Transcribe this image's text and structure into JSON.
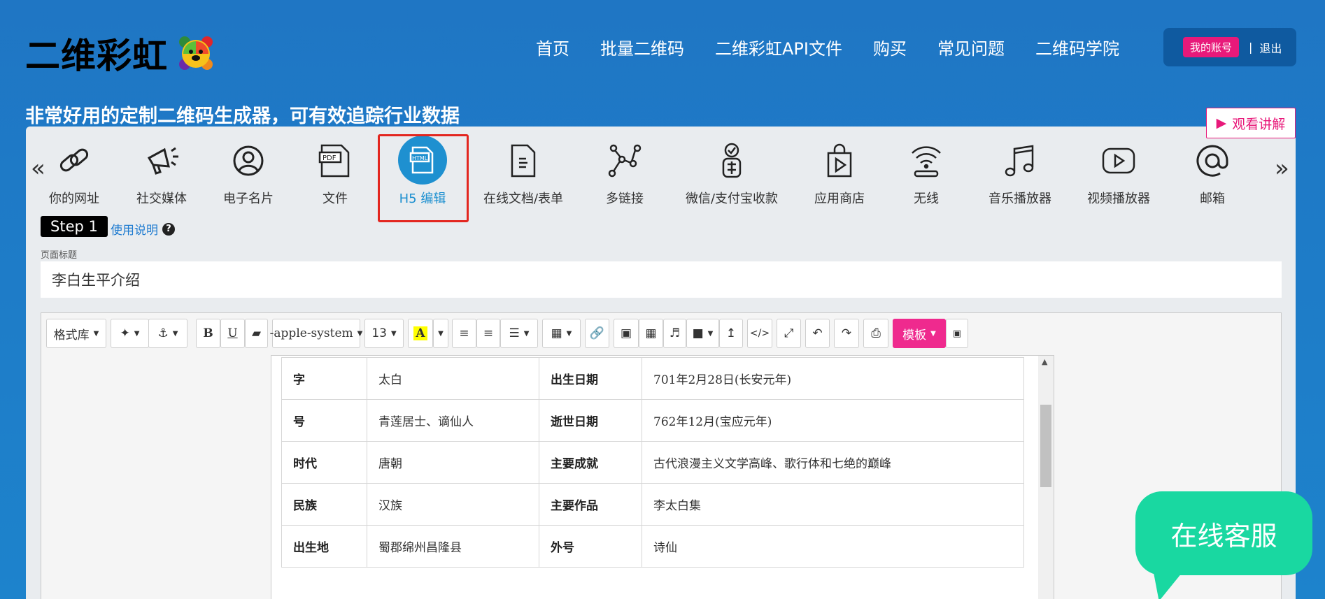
{
  "header": {
    "logo_text": "二维彩虹",
    "nav": [
      "首页",
      "批量二维码",
      "二维彩虹API文件",
      "购买",
      "常见问题",
      "二维码学院"
    ],
    "account_label": "我的账号",
    "separator": "|",
    "logout_label": "退出"
  },
  "slogan": "非常好用的定制二维码生成器，可有效追踪行业数据",
  "watch_button": {
    "icon": "play-icon",
    "label": "观看讲解"
  },
  "carousel": {
    "prev": "«",
    "next": "»",
    "types": [
      {
        "label": "你的网址",
        "icon": "link-icon"
      },
      {
        "label": "社交媒体",
        "icon": "megaphone-icon"
      },
      {
        "label": "电子名片",
        "icon": "user-circle-icon"
      },
      {
        "label": "文件",
        "icon": "pdf-file-icon"
      },
      {
        "label": "H5 编辑",
        "icon": "html-file-icon",
        "active": true
      },
      {
        "label": "在线文档/表单",
        "icon": "document-icon"
      },
      {
        "label": "多链接",
        "icon": "network-icon"
      },
      {
        "label": "微信/支付宝收款",
        "icon": "payment-icon"
      },
      {
        "label": "应用商店",
        "icon": "shopping-bag-icon"
      },
      {
        "label": "无线",
        "icon": "wifi-icon"
      },
      {
        "label": "音乐播放器",
        "icon": "music-icon"
      },
      {
        "label": "视频播放器",
        "icon": "video-play-icon"
      },
      {
        "label": "邮箱",
        "icon": "at-sign-icon"
      }
    ]
  },
  "step": {
    "label": "Step 1",
    "help_label": "使用说明",
    "help_icon": "?"
  },
  "page_title": {
    "label": "页面标题",
    "value": "李白生平介绍"
  },
  "toolbar": {
    "style": "格式库",
    "font_family": "-apple-system",
    "font_size": "13",
    "template_label": "模板"
  },
  "table": {
    "rows": [
      [
        "字",
        "太白",
        "出生日期",
        "701年2月28日(长安元年)"
      ],
      [
        "号",
        "青莲居士、谪仙人",
        "逝世日期",
        "762年12月(宝应元年)"
      ],
      [
        "时代",
        "唐朝",
        "主要成就",
        "古代浪漫主义文学高峰、歌行体和七绝的巅峰"
      ],
      [
        "民族",
        "汉族",
        "主要作品",
        "李太白集"
      ],
      [
        "出生地",
        "蜀郡绵州昌隆县",
        "外号",
        "诗仙"
      ]
    ]
  },
  "chat_label": "在线客服",
  "colors": {
    "accent": "#1e90d0",
    "brand_pink": "#e8197a",
    "chat_green": "#19d8a1",
    "highlight_red": "#e3261f"
  }
}
